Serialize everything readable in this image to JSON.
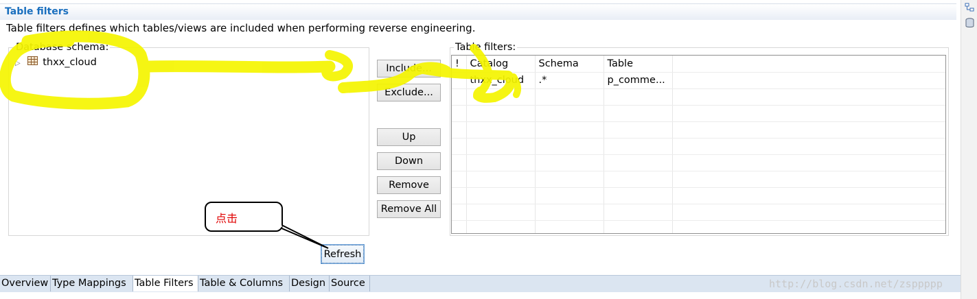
{
  "section": {
    "title": "Table filters",
    "description": "Table filters defines which tables/views are included when performing reverse engineering."
  },
  "schema_panel": {
    "label": "Database schema:",
    "tree_items": [
      "thxx_cloud"
    ]
  },
  "buttons": {
    "include": "Include...",
    "exclude": "Exclude...",
    "up": "Up",
    "down": "Down",
    "remove": "Remove",
    "remove_all": "Remove All",
    "refresh": "Refresh"
  },
  "filters_panel": {
    "label": "Table filters:",
    "columns": [
      "!",
      "Catalog",
      "Schema",
      "Table"
    ],
    "rows": [
      {
        "flag": "",
        "catalog": "thxx_cloud",
        "schema": ".*",
        "table": "p_comme..."
      }
    ]
  },
  "callout": {
    "text": "点击"
  },
  "tabs": [
    "Overview",
    "Type Mappings",
    "Table Filters",
    "Table & Columns",
    "Design",
    "Source"
  ],
  "active_tab": "Table Filters",
  "watermark": "http://blog.csdn.net/zsppppp",
  "colors": {
    "title_blue": "#1a6fbe",
    "highlight_yellow": "#f5f500",
    "callout_red": "#e00000",
    "tab_bar": "#dbe5f1"
  }
}
